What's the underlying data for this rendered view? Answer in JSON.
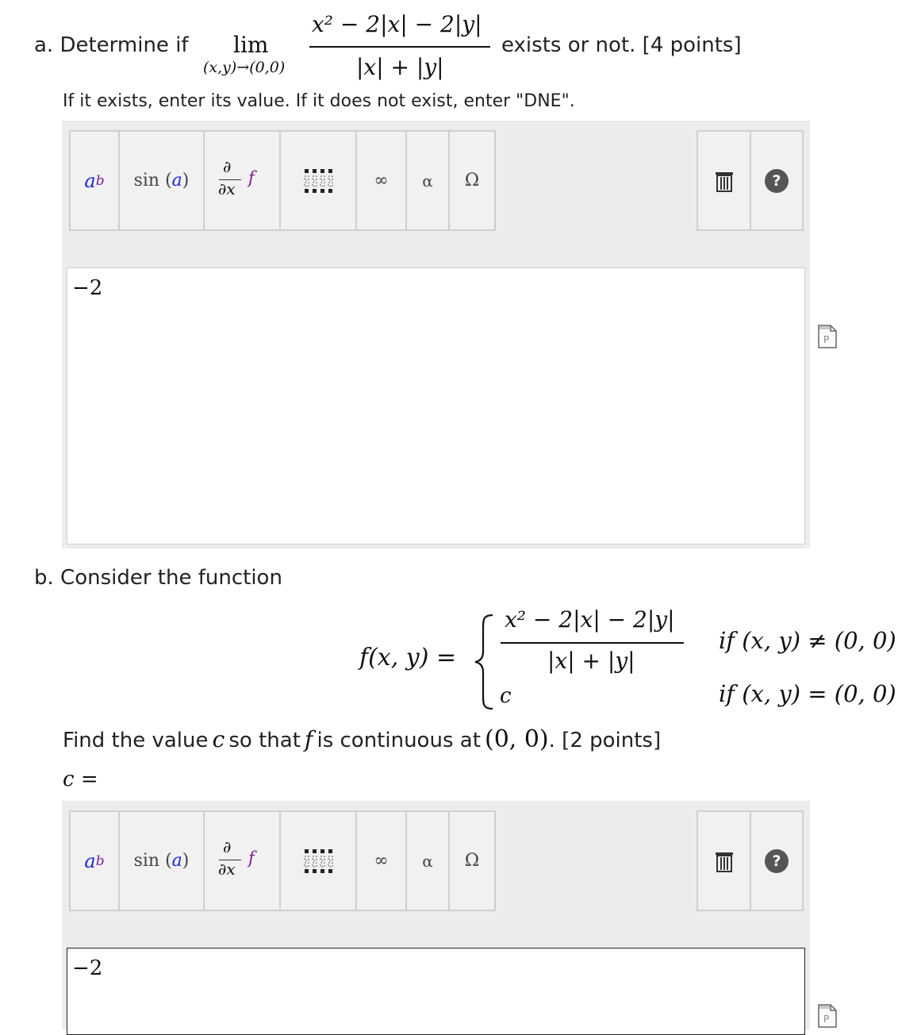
{
  "part_a": {
    "prefix": "a. Determine if",
    "lim_word": "lim",
    "lim_sub": "(x,y)→(0,0)",
    "numerator": "x² − 2|x| − 2|y|",
    "denominator": "|x| + |y|",
    "suffix": "exists or not. [4 points]",
    "instruction": "If it exists, enter its value. If it does not exist, enter \"DNE\".",
    "answer": "−2"
  },
  "part_b": {
    "prefix": "b. Consider the function",
    "f_label": "f(x, y) =",
    "case1_num": "x² − 2|x| − 2|y|",
    "case1_den": "|x| + |y|",
    "case1_cond": "if (x, y) ≠ (0, 0)",
    "case2_val": "c",
    "case2_cond": "if (x, y) = (0, 0)",
    "find_text_1": "Find the value",
    "find_c": "c",
    "find_text_2": "so that",
    "find_f": "f",
    "find_text_3": "is continuous at",
    "find_point": "(0, 0)",
    "find_text_4": ". [2 points]",
    "c_equals": "c =",
    "answer": "−2"
  },
  "toolbar": {
    "power_base": "a",
    "power_exp": "b",
    "sin_label": "sin",
    "sin_arg": "a",
    "partial_num": "∂",
    "partial_den": "∂x",
    "partial_f": "f",
    "infinity": "∞",
    "alpha": "α",
    "omega": "Ω",
    "help": "?"
  },
  "icons": {
    "matrix": "matrix-icon",
    "trash": "trash-icon",
    "help": "help-icon",
    "preview": "pdf-preview-icon"
  },
  "colors": {
    "panel_bg": "#ececec",
    "toolbar_bg": "#f1f1f1",
    "power_a": "#1a2bd0",
    "power_b": "#7a1b9a",
    "sin_arg": "#1a2bd0",
    "partial_f": "#7a1b9a",
    "help_bg": "#555555"
  }
}
